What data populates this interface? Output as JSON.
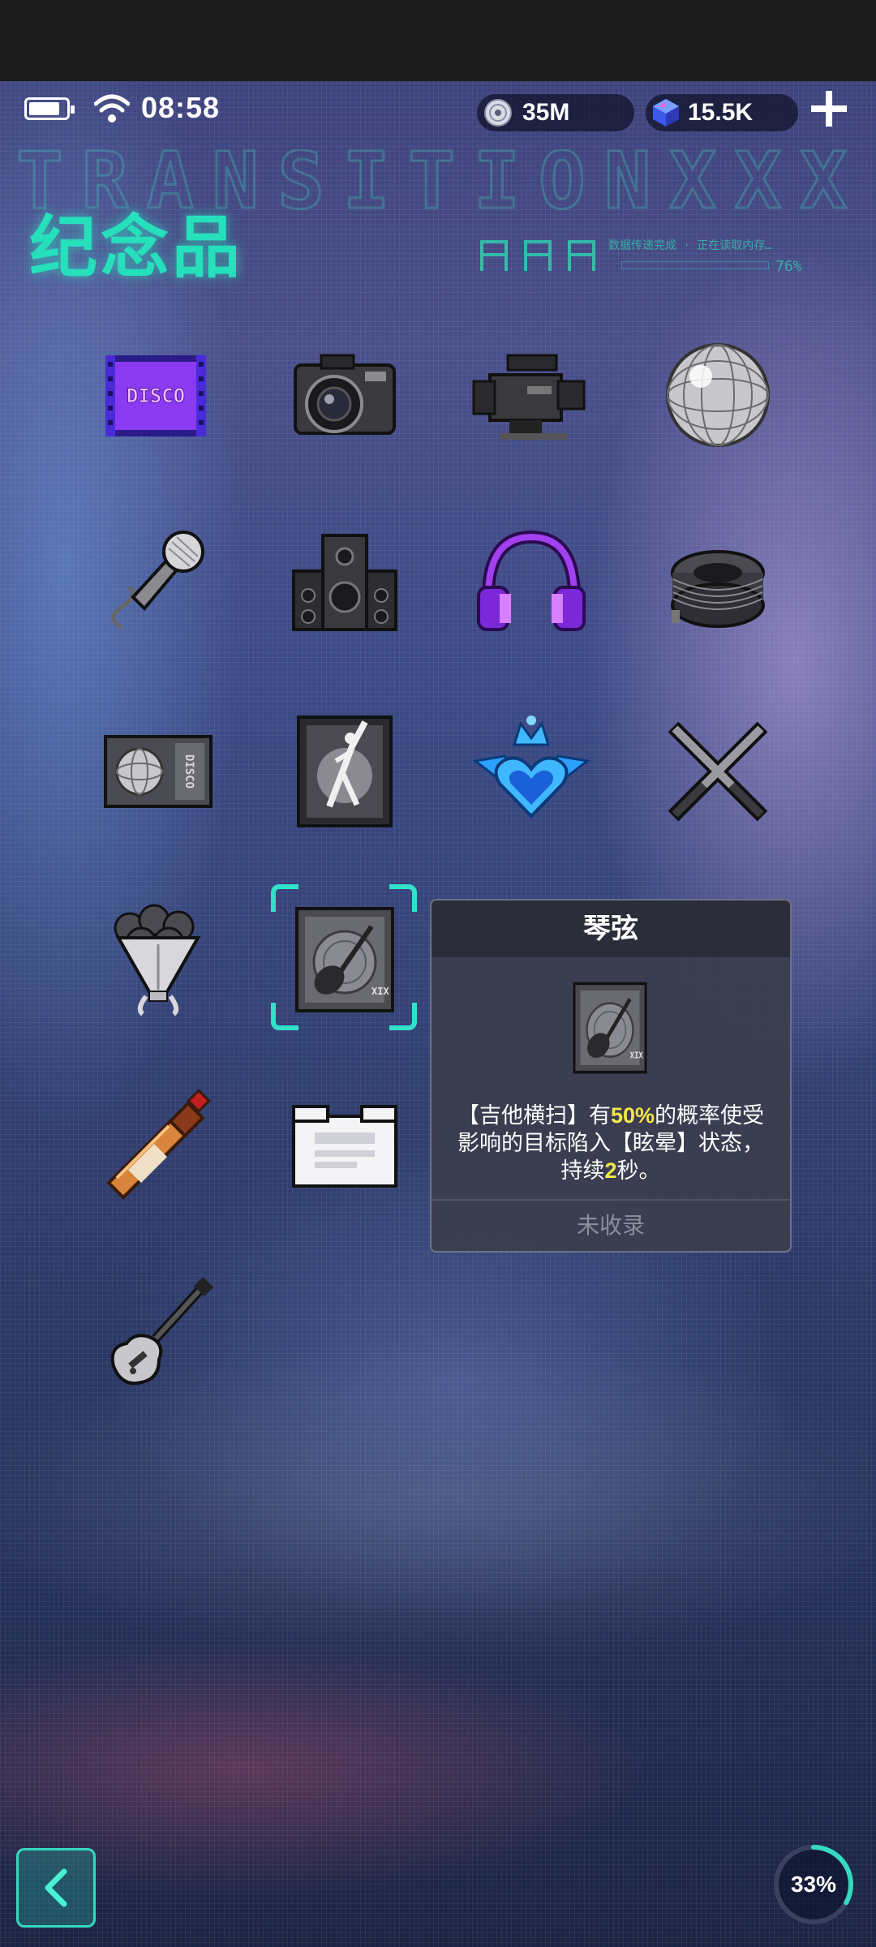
{
  "status_bar": {
    "time": "08:58",
    "battery_level": 0.85
  },
  "currencies": [
    {
      "icon": "disc-coin-icon",
      "value": "35M"
    },
    {
      "icon": "blue-gem-icon",
      "value": "15.5K"
    }
  ],
  "banner": {
    "watermark": "TRANSITIONXXX",
    "small_text": "数据传递完成 · 正在读取内存…",
    "percent": "76%"
  },
  "page_title": "纪念品",
  "items": [
    {
      "name": "disco-ticket-icon"
    },
    {
      "name": "camera-icon"
    },
    {
      "name": "video-camera-icon"
    },
    {
      "name": "disco-ball-icon"
    },
    {
      "name": "microphone-icon"
    },
    {
      "name": "speaker-icon"
    },
    {
      "name": "headphones-icon"
    },
    {
      "name": "cable-coil-icon"
    },
    {
      "name": "disco-card-icon"
    },
    {
      "name": "dancer-poster-icon"
    },
    {
      "name": "heart-crown-icon"
    },
    {
      "name": "crossed-lightsticks-icon"
    },
    {
      "name": "bouquet-icon"
    },
    {
      "name": "guitar-record-icon",
      "selected": true
    },
    {
      "name": "bottle-icon"
    },
    {
      "name": "white-box-icon"
    },
    {
      "name": "electric-guitar-icon"
    }
  ],
  "tooltip": {
    "title": "琴弦",
    "desc_parts": [
      "【吉他横扫】有",
      "50%",
      "的概率使受影响的目标陷入【眩晕】状态，持续",
      "2",
      "秒。"
    ],
    "status": "未收录"
  },
  "progress": {
    "label": "33%",
    "value": 0.33
  },
  "colors": {
    "accent": "#26e0bc",
    "highlight": "#f4e64a"
  }
}
